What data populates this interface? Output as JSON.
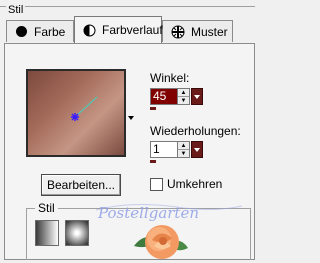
{
  "frame_title": "Stil",
  "tabs": [
    {
      "label": "Farbe",
      "icon": "filled-circle-icon",
      "active": false
    },
    {
      "label": "Farbverlauf",
      "icon": "half-circle-icon",
      "active": true
    },
    {
      "label": "Muster",
      "icon": "pattern-grid-icon",
      "active": false
    }
  ],
  "gradient": {
    "colors": [
      "#7c4a3e",
      "#a36a59",
      "#c59684",
      "#7a4a3f"
    ]
  },
  "winkel": {
    "label": "Winkel:",
    "value": "45"
  },
  "wiederholungen": {
    "label": "Wiederholungen:",
    "value": "1"
  },
  "edit_button": {
    "label": "Bearbeiten..."
  },
  "umkehren": {
    "label": "Umkehren",
    "checked": false
  },
  "stil_group": {
    "title": "Stil"
  },
  "watermark_text": "Postellgarten"
}
